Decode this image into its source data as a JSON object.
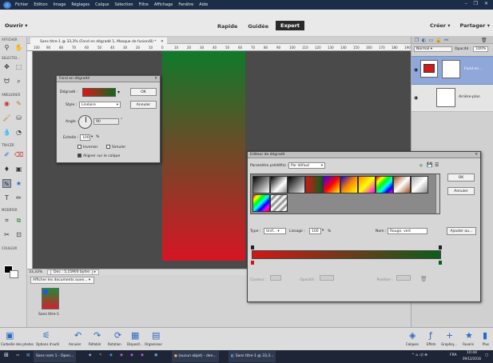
{
  "menu": {
    "items": [
      "Fichier",
      "Edition",
      "Image",
      "Réglages",
      "Calque",
      "Sélection",
      "Filtre",
      "Affichage",
      "Fenêtre",
      "Aide"
    ],
    "window_controls": [
      "–",
      "❐",
      "✕"
    ]
  },
  "topbar": {
    "open_label": "Ouvrir",
    "modes": [
      "Rapide",
      "Guidée",
      "Expert"
    ],
    "active_mode": "Expert",
    "create_label": "Créer",
    "share_label": "Partager"
  },
  "tools": {
    "labels": [
      "AFFICHER",
      "SELECTIO...",
      "AMELIORER",
      "TRACER",
      "MODIFIER",
      "COULEUR"
    ]
  },
  "document": {
    "tab_title": "Sans titre-1 @ 33,3% (Fond en dégradé 1, Masque de fusion/8) *",
    "ruler_ticks": [
      "100",
      "90",
      "80",
      "70",
      "60",
      "50",
      "40",
      "30",
      "20",
      "10",
      "0",
      "10",
      "20",
      "30",
      "40",
      "50",
      "60",
      "70",
      "80",
      "90",
      "100",
      "110",
      "120",
      "130",
      "140",
      "150",
      "160",
      "170",
      "180",
      "190"
    ],
    "zoom": "33,33%",
    "doc_info": "Doc : 5,15M/0 bytes"
  },
  "bin": {
    "select_label": "Afficher les documents ouve...",
    "thumb_label": "Sans titre-1"
  },
  "layers": {
    "blend_mode": "Normal",
    "opacity_label": "Opacité :",
    "opacity_value": "100%",
    "layer1_name": "Fond en ...",
    "layer2_name": "Arrière-plan"
  },
  "gradient_fill_dialog": {
    "title": "Fond en dégradé",
    "gradient_label": "Dégradé :",
    "style_label": "Style :",
    "style_value": "Linéaire",
    "angle_label": "Angle :",
    "angle_value": "90",
    "angle_unit": "°",
    "scale_label": "Echelle :",
    "scale_value": "100",
    "scale_unit": "%",
    "reverse_label": "Inverser",
    "dither_label": "Simuler",
    "align_label": "Aligner sur le calque",
    "ok_label": "OK",
    "cancel_label": "Annuler"
  },
  "gradient_editor": {
    "title": "Editeur de dégradé",
    "preset_label": "Paramètre prédéfini :",
    "preset_value": "Par défaut",
    "ok_label": "OK",
    "cancel_label": "Annuler",
    "type_label": "Type :",
    "type_value": "Unif...",
    "smooth_label": "Lissage :",
    "smooth_value": "100",
    "smooth_unit": "%",
    "name_label": "Nom :",
    "name_value": "Rouge, vert",
    "add_label": "Ajouter au...",
    "color_label": "Couleur :",
    "opacity_label": "Opacité :",
    "location_label": "Position :"
  },
  "bottombar": {
    "buttons": [
      "Corbeille des photos",
      "Options d'outil",
      "Annuler",
      "Rétablir",
      "Rotation",
      "Disposit...",
      "Organiseur"
    ],
    "right_buttons": [
      "Calques",
      "Effets",
      "Graphiq...",
      "Favoris",
      "Plus"
    ]
  },
  "taskbar": {
    "items": [
      "Sans nom 1 - Open...",
      "(aucun objet) - den...",
      "Sans titre-1 @ 33,3..."
    ],
    "lang": "FRA",
    "time": "10:44",
    "date": "09/12/2016"
  },
  "colors": {
    "accent": "#8fa7d9",
    "grad_start": "#d11717",
    "grad_end": "#0c5e1a"
  }
}
